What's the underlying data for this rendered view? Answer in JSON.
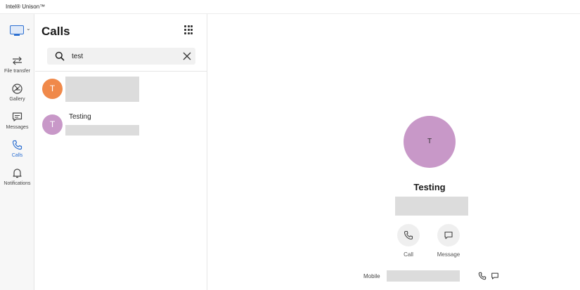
{
  "window": {
    "title": "Intel® Unison™"
  },
  "nav": {
    "items": [
      {
        "label": "File transfer",
        "icon": "file-transfer-icon",
        "active": false
      },
      {
        "label": "Gallery",
        "icon": "gallery-icon",
        "active": false
      },
      {
        "label": "Messages",
        "icon": "messages-icon",
        "active": false
      },
      {
        "label": "Calls",
        "icon": "calls-icon",
        "active": true
      },
      {
        "label": "Notifications",
        "icon": "notifications-icon",
        "active": false
      }
    ]
  },
  "calls": {
    "title": "Calls",
    "search": {
      "value": "test"
    },
    "results": [
      {
        "initial": "T",
        "name": "",
        "avatar_color": "#f0894a"
      },
      {
        "initial": "T",
        "name": "Testing",
        "avatar_color": "#c898c8"
      }
    ]
  },
  "detail": {
    "initial": "T",
    "avatar_color": "#c898c8",
    "name": "Testing",
    "actions": {
      "call_label": "Call",
      "message_label": "Message"
    },
    "number_type": "Mobile"
  },
  "colors": {
    "accent": "#2c6fd1",
    "redacted": "#dcdcdc"
  }
}
